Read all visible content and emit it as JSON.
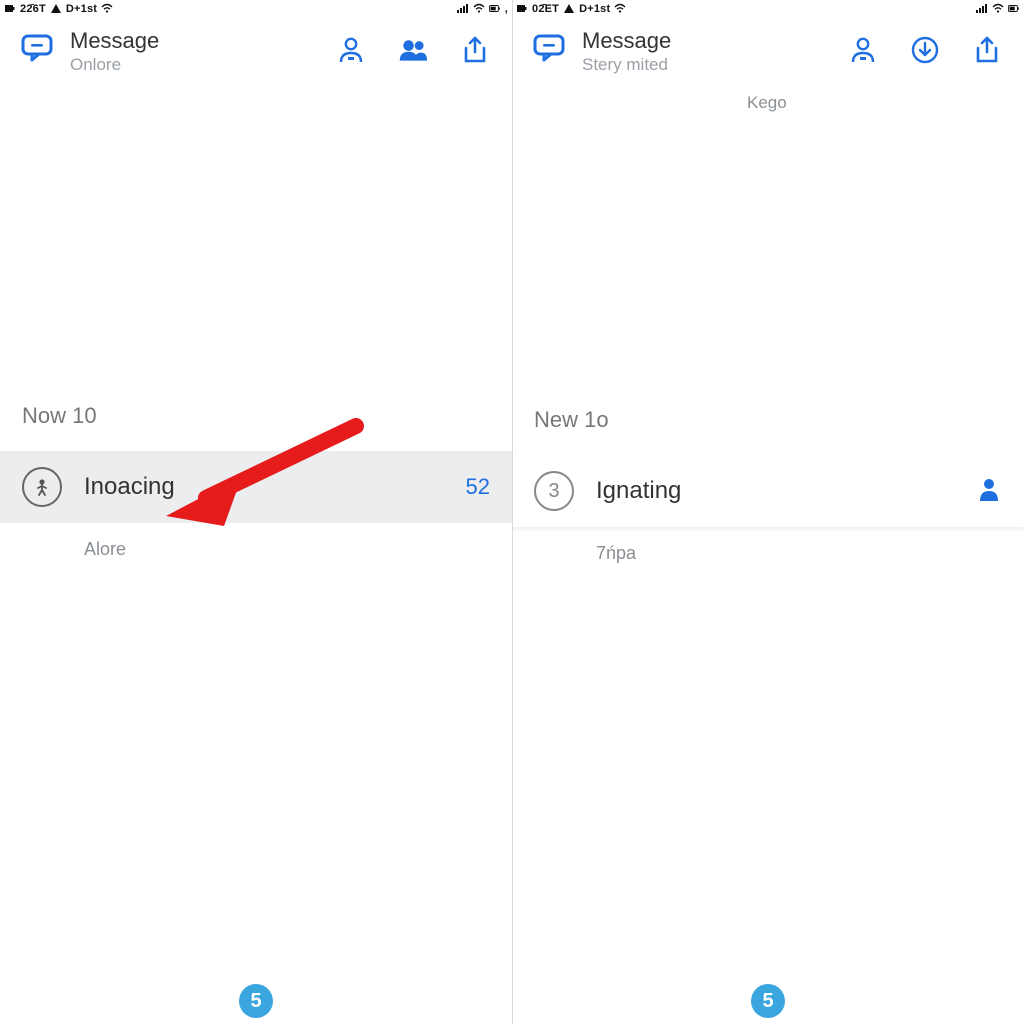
{
  "left": {
    "status": {
      "time": "22̄6T",
      "carrier": "D+1st"
    },
    "header": {
      "title": "Message",
      "subtitle": "Onlore"
    },
    "section_label": "Now 10",
    "row": {
      "title": "Inoacing",
      "count": "52"
    },
    "subtext": "Alore",
    "fab_label": "5"
  },
  "right": {
    "status": {
      "time": "02̄ET",
      "carrier": "D+1st"
    },
    "header": {
      "title": "Message",
      "subtitle": "Stery mited"
    },
    "kego": "Kego",
    "section_label": "New 1o",
    "row": {
      "title": "Ignating",
      "avatar_num": "3"
    },
    "subtext": "7ńpa",
    "fab_label": "5"
  },
  "colors": {
    "accent": "#1f6fe0",
    "fab": "#3aa6e0",
    "arrow": "#e61b1b"
  }
}
